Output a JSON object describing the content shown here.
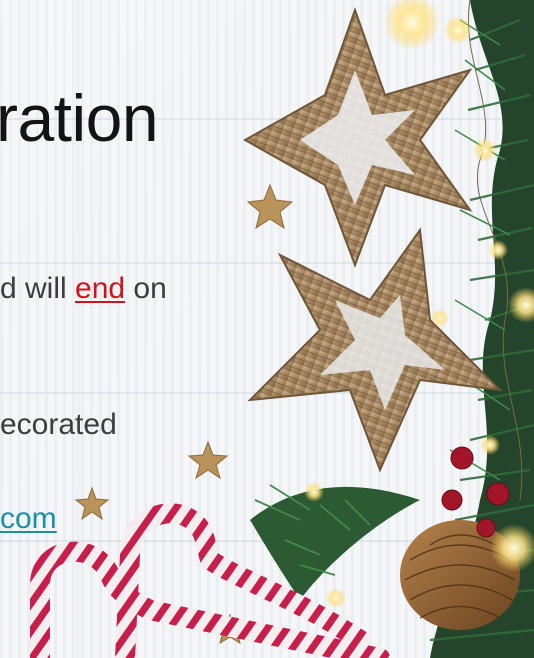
{
  "slide": {
    "title_fragment": "ration",
    "line1_before": "d will ",
    "line1_link": "end",
    "line1_after": " on",
    "line2": "ecorated",
    "line3_link": "com"
  },
  "icons": {
    "star_decor_1": "wicker-star-icon",
    "star_decor_2": "wicker-star-icon",
    "candy_cane": "candy-cane-icon",
    "pine_cone": "pine-cone-icon",
    "fir_branch": "fir-branch-icon",
    "small_star": "gold-star-icon",
    "light": "string-light-icon"
  },
  "colors": {
    "link_red": "#d0141c",
    "link_teal": "#1a8fa6",
    "body_text": "#3d3d3d",
    "title_text": "#141414"
  }
}
